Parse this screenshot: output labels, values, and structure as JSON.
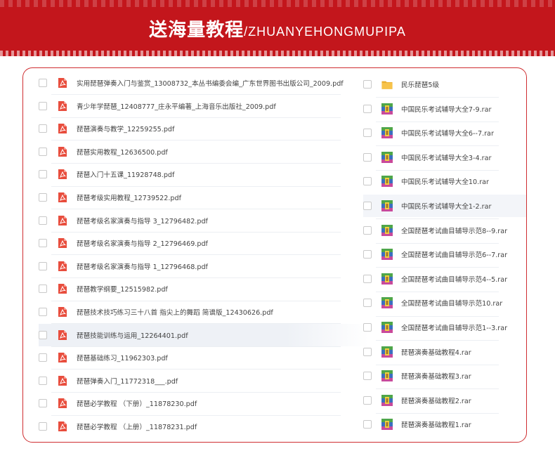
{
  "banner": {
    "title_zh": "送海量教程",
    "title_en": "/ZHUANYEHONGMUPIPA"
  },
  "left_files": [
    {
      "name": "实用琵琶弹奏入门与鉴赏_13008732_本丛书编委会编_广东世界图书出版公司_2009.pdf",
      "icon": "pdf-icon"
    },
    {
      "name": "青少年学琵琶_12408777_庄永平编著_上海音乐出版社_2009.pdf",
      "icon": "pdf-icon"
    },
    {
      "name": "琵琶演奏与教学_12259255.pdf",
      "icon": "pdf-icon"
    },
    {
      "name": "琵琶实用教程_12636500.pdf",
      "icon": "pdf-icon"
    },
    {
      "name": "琵琶入门十五课_11928748.pdf",
      "icon": "pdf-icon"
    },
    {
      "name": "琵琶考级实用教程_12739522.pdf",
      "icon": "pdf-icon"
    },
    {
      "name": "琵琶考级名家演奏与指导 3_12796482.pdf",
      "icon": "pdf-icon"
    },
    {
      "name": "琵琶考级名家演奏与指导 2_12796469.pdf",
      "icon": "pdf-icon"
    },
    {
      "name": "琵琶考级名家演奏与指导 1_12796468.pdf",
      "icon": "pdf-icon"
    },
    {
      "name": "琵琶教学纲要_12515982.pdf",
      "icon": "pdf-icon"
    },
    {
      "name": "琵琶技术技巧练习三十八首 指尖上的舞蹈 简谱版_12430626.pdf",
      "icon": "pdf-icon"
    },
    {
      "name": "琵琶技能训练与运用_12264401.pdf",
      "icon": "pdf-icon"
    },
    {
      "name": "琵琶基础练习_11962303.pdf",
      "icon": "pdf-icon"
    },
    {
      "name": "琵琶弹奏入门_11772318___.pdf",
      "icon": "pdf-icon"
    },
    {
      "name": "琵琶必学教程 （下册）_11878230.pdf",
      "icon": "pdf-icon"
    },
    {
      "name": "琵琶必学教程 （上册）_11878231.pdf",
      "icon": "pdf-icon"
    }
  ],
  "right_files": [
    {
      "name": "民乐琵琶5级",
      "icon": "folder-icon"
    },
    {
      "name": "中国民乐考试辅导大全7-9.rar",
      "icon": "rar-icon"
    },
    {
      "name": "中国民乐考试辅导大全6--7.rar",
      "icon": "rar-icon"
    },
    {
      "name": "中国民乐考试辅导大全3-4.rar",
      "icon": "rar-icon"
    },
    {
      "name": "中国民乐考试辅导大全10.rar",
      "icon": "rar-icon"
    },
    {
      "name": "中国民乐考试辅导大全1-2.rar",
      "icon": "rar-icon"
    },
    {
      "name": "全国琵琶考试曲目辅导示范8--9.rar",
      "icon": "rar-icon"
    },
    {
      "name": "全国琵琶考试曲目辅导示范6--7.rar",
      "icon": "rar-icon"
    },
    {
      "name": "全国琵琶考试曲目辅导示范4--5.rar",
      "icon": "rar-icon"
    },
    {
      "name": "全国琵琶考试曲目辅导示范10.rar",
      "icon": "rar-icon"
    },
    {
      "name": "全国琵琶考试曲目辅导示范1--3.rar",
      "icon": "rar-icon"
    },
    {
      "name": "琵琶演奏基础教程4.rar",
      "icon": "rar-icon"
    },
    {
      "name": "琵琶演奏基础教程3.rar",
      "icon": "rar-icon"
    },
    {
      "name": "琵琶演奏基础教程2.rar",
      "icon": "rar-icon"
    },
    {
      "name": "琵琶演奏基础教程1.rar",
      "icon": "rar-icon"
    }
  ],
  "colors": {
    "banner": "#c3161c",
    "panel_border": "#cf2e31",
    "pdf_icon": "#e84d3d",
    "folder_icon": "#f7c34a"
  },
  "highlight": {
    "left_row": "琵琶技能训练与运用_12264401.pdf",
    "right_row": "中国民乐考试辅导大全1-2.rar"
  }
}
